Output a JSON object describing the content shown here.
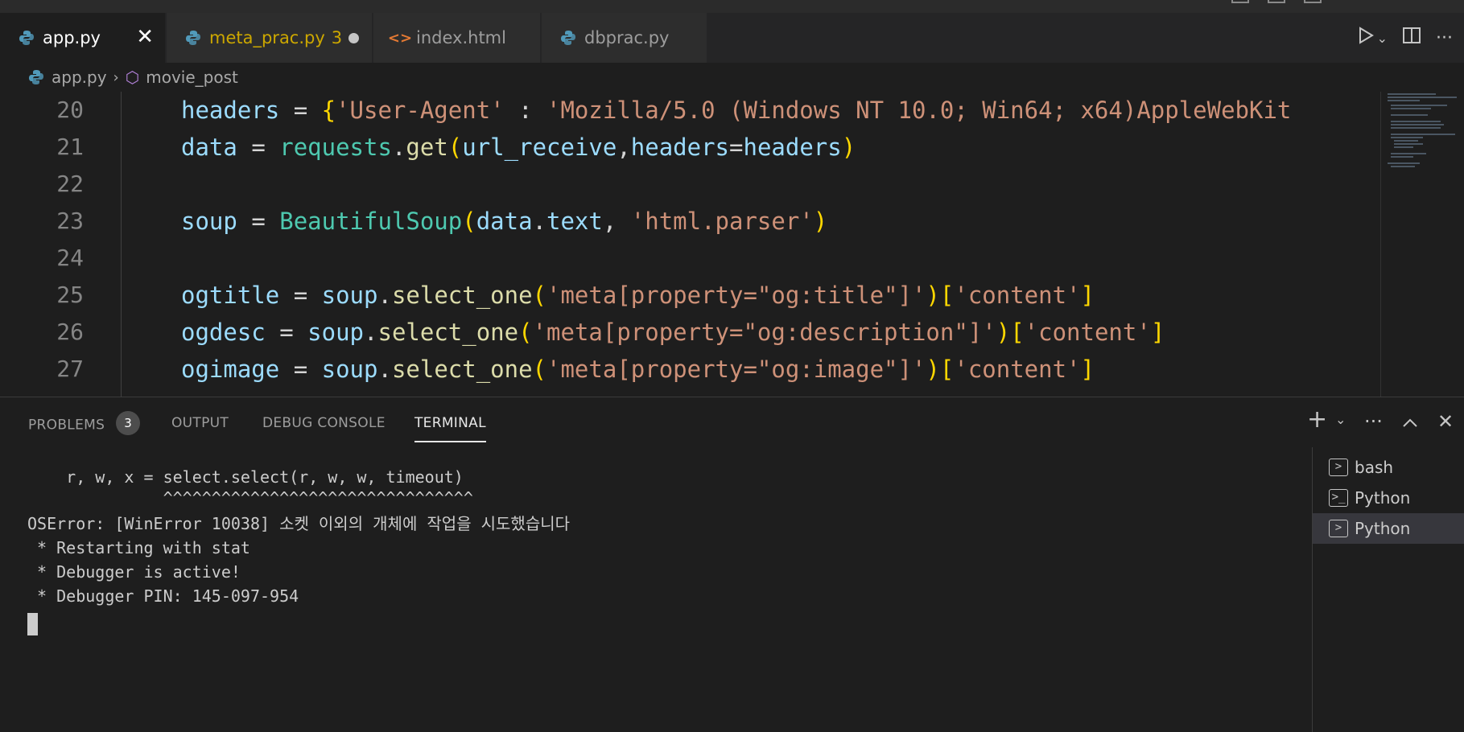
{
  "tabs": [
    {
      "label": "app.py",
      "icon": "python-icon",
      "active": true
    },
    {
      "label": "meta_prac.py",
      "count": "3",
      "icon": "python-icon",
      "modified": true
    },
    {
      "label": "index.html",
      "icon": "html-icon"
    },
    {
      "label": "dbprac.py",
      "icon": "python-icon"
    }
  ],
  "breadcrumb": {
    "file": "app.py",
    "symbol": "movie_post"
  },
  "editor": {
    "line_numbers": [
      "20",
      "21",
      "22",
      "23",
      "24",
      "25",
      "26",
      "27"
    ],
    "lines": [
      "headers = {'User-Agent' : 'Mozilla/5.0 (Windows NT 10.0; Win64; x64)AppleWebKit",
      "data = requests.get(url_receive,headers=headers)",
      "",
      "soup = BeautifulSoup(data.text, 'html.parser')",
      "",
      "ogtitle = soup.select_one('meta[property=\"og:title\"]')['content']",
      "ogdesc = soup.select_one('meta[property=\"og:description\"]')['content']",
      "ogimage = soup.select_one('meta[property=\"og:image\"]')['content']"
    ]
  },
  "panel": {
    "tabs": {
      "problems": "PROBLEMS",
      "problems_count": "3",
      "output": "OUTPUT",
      "debug_console": "DEBUG CONSOLE",
      "terminal": "TERMINAL"
    },
    "terminal_lines": [
      "    r, w, x = select.select(r, w, w, timeout)",
      "              ^^^^^^^^^^^^^^^^^^^^^^^^^^^^^^^^",
      "OSError: [WinError 10038] 소켓 이외의 개체에 작업을 시도했습니다",
      " * Restarting with stat",
      " * Debugger is active!",
      " * Debugger PIN: 145-097-954"
    ],
    "terminal_list": [
      {
        "label": "bash",
        "icon": "terminal-icon"
      },
      {
        "label": "Python",
        "icon": "powershell-icon"
      },
      {
        "label": "Python",
        "icon": "terminal-icon",
        "active": true
      }
    ]
  },
  "colors": {
    "keyword_var": "#9cdcfe",
    "string": "#ce9178",
    "function": "#dcdcaa",
    "class": "#4ec9b0",
    "bracket": "#ffd700",
    "modified_tab": "#cca700"
  }
}
